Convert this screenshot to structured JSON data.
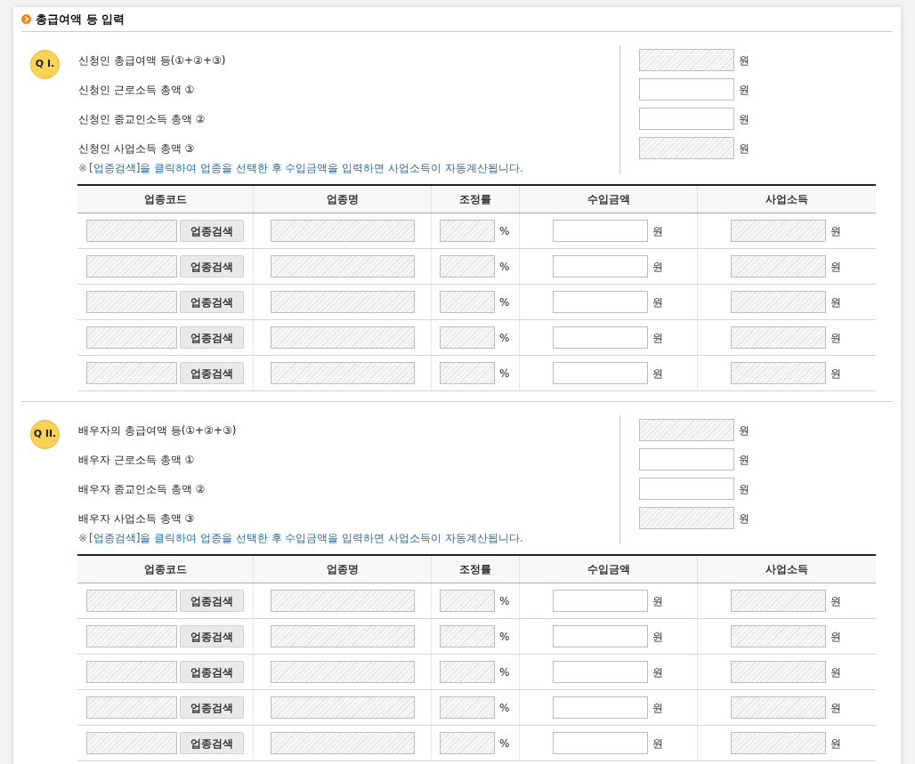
{
  "title": "총급여액 등 입력",
  "sections": [
    {
      "badge": "Q I.",
      "fields": [
        {
          "label": "신청인 총급여액 등(①+②+③)",
          "disabled": true,
          "unit": "원"
        },
        {
          "label": "신청인 근로소득 총액 ①",
          "disabled": false,
          "unit": "원"
        },
        {
          "label": "신청인 종교인소득 총액 ②",
          "disabled": false,
          "unit": "원"
        },
        {
          "label": "신청인 사업소득 총액 ③",
          "disabled": true,
          "unit": "원"
        }
      ],
      "note_mark": "※",
      "note": "[업종검색]을 클릭하여 업종을 선택한 후 수입금액을 입력하면 사업소득이 자동계산됩니다.",
      "table": {
        "columns": [
          "업종코드",
          "업종명",
          "조정률",
          "수입금액",
          "사업소득"
        ],
        "rows": [
          {
            "button": "업종검색",
            "rate_unit": "%",
            "income_unit": "원",
            "profit_unit": "원",
            "income_disabled": false
          },
          {
            "button": "업종검색",
            "rate_unit": "%",
            "income_unit": "원",
            "profit_unit": "원",
            "income_disabled": false
          },
          {
            "button": "업종검색",
            "rate_unit": "%",
            "income_unit": "원",
            "profit_unit": "원",
            "income_disabled": false
          },
          {
            "button": "업종검색",
            "rate_unit": "%",
            "income_unit": "원",
            "profit_unit": "원",
            "income_disabled": false
          },
          {
            "button": "업종검색",
            "rate_unit": "%",
            "income_unit": "원",
            "profit_unit": "원",
            "income_disabled": false
          }
        ]
      }
    },
    {
      "badge": "Q II.",
      "fields": [
        {
          "label": "배우자의 총급여액 등(①+②+③)",
          "disabled": true,
          "unit": "원"
        },
        {
          "label": "배우자 근로소득 총액 ①",
          "disabled": false,
          "unit": "원"
        },
        {
          "label": "배우자 종교인소득 총액 ②",
          "disabled": false,
          "unit": "원"
        },
        {
          "label": "배우자 사업소득 총액 ③",
          "disabled": true,
          "unit": "원"
        }
      ],
      "note_mark": "※",
      "note": "[업종검색]을 클릭하여 업종을 선택한 후 수입금액을 입력하면 사업소득이 자동계산됩니다.",
      "table": {
        "columns": [
          "업종코드",
          "업종명",
          "조정률",
          "수입금액",
          "사업소득"
        ],
        "rows": [
          {
            "button": "업종검색",
            "rate_unit": "%",
            "income_unit": "원",
            "profit_unit": "원",
            "income_disabled": false
          },
          {
            "button": "업종검색",
            "rate_unit": "%",
            "income_unit": "원",
            "profit_unit": "원",
            "income_disabled": false
          },
          {
            "button": "업종검색",
            "rate_unit": "%",
            "income_unit": "원",
            "profit_unit": "원",
            "income_disabled": false
          },
          {
            "button": "업종검색",
            "rate_unit": "%",
            "income_unit": "원",
            "profit_unit": "원",
            "income_disabled": false
          },
          {
            "button": "업종검색",
            "rate_unit": "%",
            "income_unit": "원",
            "profit_unit": "원",
            "income_disabled": false
          }
        ]
      }
    }
  ]
}
